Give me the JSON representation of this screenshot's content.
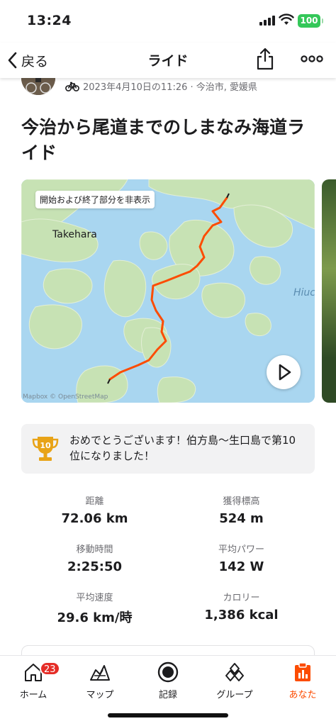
{
  "status_bar": {
    "time": "13:24",
    "battery": "100"
  },
  "nav": {
    "back_label": "戻る",
    "title": "ライド"
  },
  "activity": {
    "meta": "2023年4月10日の11:26 · 今治市, 愛媛県",
    "title": "今治から尾道までのしまなみ海道ライド"
  },
  "map": {
    "hide_endpoints_label": "開始および終了部分を非表示",
    "place_labels": [
      "Takehara",
      "Hiuc"
    ],
    "attribution": "Mapbox © OpenStreetMap",
    "route_color": "#fc4c02"
  },
  "achievement": {
    "rank": "10",
    "text": "おめでとうございます！伯方島～生口島で第10位になりました！"
  },
  "stats": [
    {
      "label": "距離",
      "value": "72.06 km"
    },
    {
      "label": "獲得標高",
      "value": "524 m"
    },
    {
      "label": "移動時間",
      "value": "2:25:50"
    },
    {
      "label": "平均パワー",
      "value": "142 W"
    },
    {
      "label": "平均速度",
      "value": "29.6 km/時"
    },
    {
      "label": "カロリー",
      "value": "1,386 kcal"
    }
  ],
  "tabs": [
    {
      "label": "ホーム",
      "icon": "home-icon",
      "badge": "23"
    },
    {
      "label": "マップ",
      "icon": "map-icon"
    },
    {
      "label": "記録",
      "icon": "record-icon"
    },
    {
      "label": "グループ",
      "icon": "groups-icon"
    },
    {
      "label": "あなた",
      "icon": "you-icon",
      "active": true
    }
  ],
  "colors": {
    "accent": "#fc4c02",
    "battery": "#34c759",
    "badge": "#e52d27",
    "trophy": "#e8a317"
  }
}
